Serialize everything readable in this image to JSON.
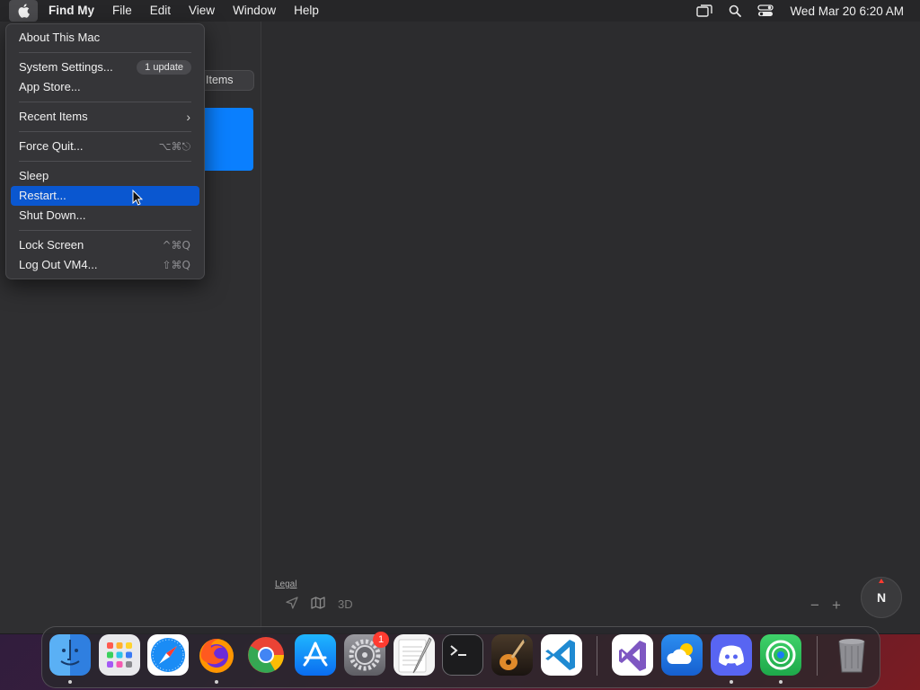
{
  "menubar": {
    "app_name": "Find My",
    "menus": [
      "File",
      "Edit",
      "View",
      "Window",
      "Help"
    ],
    "datetime": "Wed Mar 20  6:20 AM",
    "status_icons": [
      "screen-mirroring-icon",
      "spotlight-search-icon",
      "control-center-icon"
    ]
  },
  "apple_menu": {
    "items": {
      "about": "About This Mac",
      "settings": "System Settings...",
      "settings_badge": "1 update",
      "app_store": "App Store...",
      "recent": "Recent Items",
      "force_quit": "Force Quit...",
      "force_quit_shortcut": "⌥⌘⎋",
      "sleep": "Sleep",
      "restart": "Restart...",
      "shutdown": "Shut Down...",
      "lock": "Lock Screen",
      "lock_shortcut": "^⌘Q",
      "logout": "Log Out VM4...",
      "logout_shortcut": "⇧⌘Q"
    },
    "highlighted": "Restart..."
  },
  "sidebar": {
    "segment_partial_label": "Items"
  },
  "map": {
    "legal": "Legal",
    "mode_3d": "3D",
    "zoom_out": "−",
    "zoom_in": "+",
    "compass": "N"
  },
  "dock": {
    "apps": [
      "Finder",
      "Launchpad",
      "Safari",
      "Firefox",
      "Chrome",
      "App Store",
      "System Settings",
      "TextEdit",
      "Terminal",
      "GarageBand",
      "Visual Studio Code",
      "Visual Studio",
      "Weather",
      "Discord",
      "Find My",
      "Trash"
    ],
    "settings_badge": "1"
  },
  "colors": {
    "accent": "#0a57d0",
    "find_my_blue": "#0a7ffe",
    "badge_red": "#ff3b30"
  }
}
